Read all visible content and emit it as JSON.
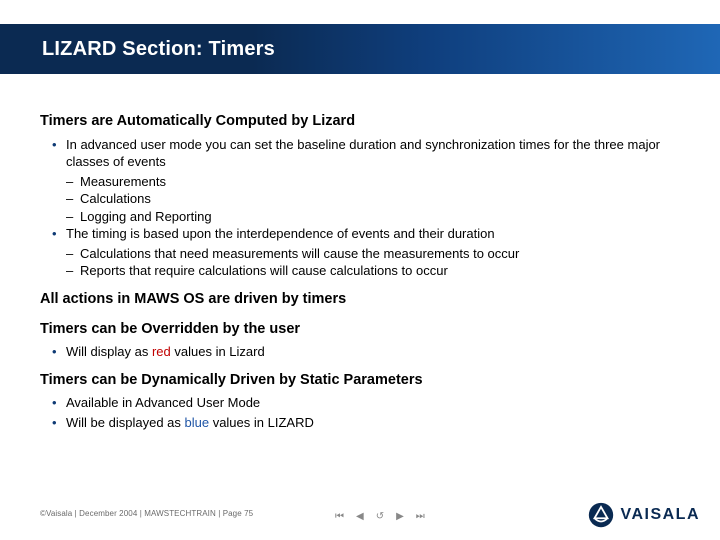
{
  "title": "LIZARD Section: Timers",
  "sec1": {
    "head": "Timers are Automatically Computed by Lizard",
    "b1": "In advanced user mode you can set the baseline duration and synchronization times for the three major classes of events",
    "d1": "Measurements",
    "d2": "Calculations",
    "d3": "Logging and Reporting",
    "b2": "The timing is based upon the interdependence of events and their duration",
    "d4": "Calculations that need measurements will cause the measurements to occur",
    "d5": "Reports that require calculations will cause calculations to occur"
  },
  "sec2": {
    "head": "All actions in MAWS OS are driven by timers"
  },
  "sec3": {
    "head": "Timers can be Overridden by the user",
    "b1_pre": "Will display as ",
    "b1_red": "red",
    "b1_post": " values in Lizard"
  },
  "sec4": {
    "head": "Timers can be Dynamically Driven by Static Parameters",
    "b1": "Available in Advanced User Mode",
    "b2_pre": "Will be displayed as ",
    "b2_blue": "blue",
    "b2_post": " values in LIZARD"
  },
  "footer": "©Vaisala | December 2004 | MAWSTECHTRAIN | Page 75",
  "nav": {
    "first": "⏮",
    "prev": "◀",
    "refresh": "↺",
    "next": "▶",
    "last": "⏭"
  },
  "logo_text": "VAISALA"
}
